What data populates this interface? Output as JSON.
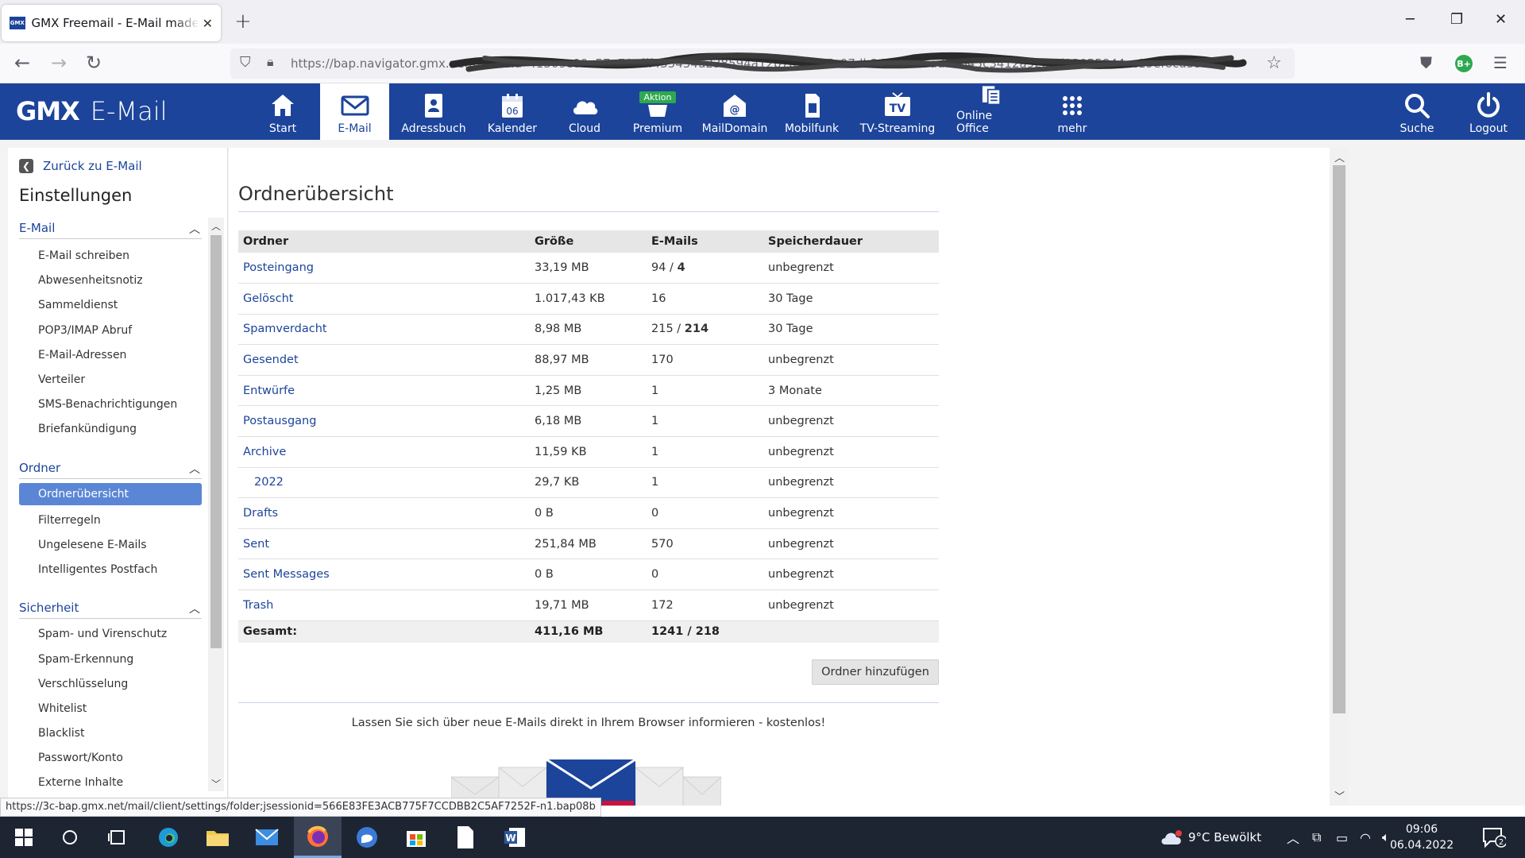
{
  "browser": {
    "tab_title": "GMX Freemail - E-Mail made in Germany",
    "tab_favicon": "GMX",
    "url": "https://bap.navigator.gmx.net/mail?sid=f1309c00e57a70afff455454d238594a12b7616aa7c97db24c16ed5ad72b45c3412a92a4d13055844cc19ef6cd35b97",
    "ext_badge": "B+",
    "status_url": "https://3c-bap.gmx.net/mail/client/settings/folder;jsessionid=566E83FE3ACB775F7CCDBB2C5AF7252F-n1.bap08b"
  },
  "header": {
    "logo_brand": "GMX",
    "logo_product": "E-Mail",
    "nav": [
      {
        "label": "Start",
        "icon": "home-icon"
      },
      {
        "label": "E-Mail",
        "icon": "envelope-icon"
      },
      {
        "label": "Adressbuch",
        "icon": "addressbook-icon"
      },
      {
        "label": "Kalender",
        "icon": "calendar-icon",
        "calendar_day": "06"
      },
      {
        "label": "Cloud",
        "icon": "cloud-icon"
      },
      {
        "label": "Premium",
        "icon": "premium-icon",
        "badge": "Aktion"
      },
      {
        "label": "MailDomain",
        "icon": "maildomain-icon"
      },
      {
        "label": "Mobilfunk",
        "icon": "simcard-icon"
      },
      {
        "label": "TV-Streaming",
        "icon": "tv-icon",
        "icon_text": "TV"
      },
      {
        "label": "Online Office",
        "icon": "office-icon"
      },
      {
        "label": "mehr",
        "icon": "grid-icon"
      },
      {
        "label": "Suche",
        "icon": "search-icon"
      },
      {
        "label": "Logout",
        "icon": "power-icon"
      }
    ]
  },
  "sidebar": {
    "back_label": "Zurück zu E-Mail",
    "title": "Einstellungen",
    "sections": [
      {
        "title": "E-Mail",
        "items": [
          "E-Mail schreiben",
          "Abwesenheitsnotiz",
          "Sammeldienst",
          "POP3/IMAP Abruf",
          "E-Mail-Adressen",
          "Verteiler",
          "SMS-Benachrichtigungen",
          "Briefankündigung"
        ]
      },
      {
        "title": "Ordner",
        "items": [
          "Ordnerübersicht",
          "Filterregeln",
          "Ungelesene E-Mails",
          "Intelligentes Postfach"
        ]
      },
      {
        "title": "Sicherheit",
        "items": [
          "Spam- und Virenschutz",
          "Spam-Erkennung",
          "Verschlüsselung",
          "Whitelist",
          "Blacklist",
          "Passwort/Konto",
          "Externe Inhalte"
        ]
      }
    ],
    "active_item": "Ordnerübersicht"
  },
  "main": {
    "title": "Ordnerübersicht",
    "columns": [
      "Ordner",
      "Größe",
      "E-Mails",
      "Speicherdauer"
    ],
    "rows": [
      {
        "name": "Posteingang",
        "size": "33,19 MB",
        "emails": "94",
        "unread": "4",
        "retention": "unbegrenzt"
      },
      {
        "name": "Gelöscht",
        "size": "1.017,43 KB",
        "emails": "16",
        "unread": "",
        "retention": "30 Tage"
      },
      {
        "name": "Spamverdacht",
        "size": "8,98 MB",
        "emails": "215",
        "unread": "214",
        "retention": "30 Tage"
      },
      {
        "name": "Gesendet",
        "size": "88,97 MB",
        "emails": "170",
        "unread": "",
        "retention": "unbegrenzt"
      },
      {
        "name": "Entwürfe",
        "size": "1,25 MB",
        "emails": "1",
        "unread": "",
        "retention": "3 Monate"
      },
      {
        "name": "Postausgang",
        "size": "6,18 MB",
        "emails": "1",
        "unread": "",
        "retention": "unbegrenzt"
      },
      {
        "name": "Archive",
        "size": "11,59 KB",
        "emails": "1",
        "unread": "",
        "retention": "unbegrenzt"
      },
      {
        "name": "2022",
        "size": "29,7 KB",
        "emails": "1",
        "unread": "",
        "retention": "unbegrenzt",
        "sub": true
      },
      {
        "name": "Drafts",
        "size": "0 B",
        "emails": "0",
        "unread": "",
        "retention": "unbegrenzt"
      },
      {
        "name": "Sent",
        "size": "251,84 MB",
        "emails": "570",
        "unread": "",
        "retention": "unbegrenzt"
      },
      {
        "name": "Sent Messages",
        "size": "0 B",
        "emails": "0",
        "unread": "",
        "retention": "unbegrenzt"
      },
      {
        "name": "Trash",
        "size": "19,71 MB",
        "emails": "172",
        "unread": "",
        "retention": "unbegrenzt"
      }
    ],
    "total": {
      "label": "Gesamt:",
      "size": "411,16 MB",
      "emails": "1241 / 218"
    },
    "add_button": "Ordner hinzufügen",
    "notify_text": "Lassen Sie sich über neue E-Mails direkt in Ihrem Browser informieren - kostenlos!"
  },
  "taskbar": {
    "weather": "9°C  Bewölkt",
    "time": "09:06",
    "date": "06.04.2022",
    "notification_count": "2"
  },
  "colors": {
    "brand": "#1c449b",
    "active_sidebar": "#5b86d6",
    "badge_green": "#2fa84f"
  }
}
